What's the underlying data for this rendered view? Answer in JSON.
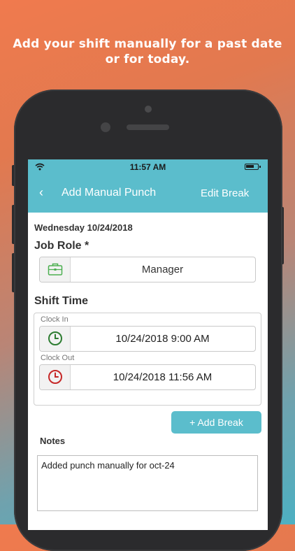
{
  "headline": {
    "line1": "Add your shift manually for a past date",
    "line2": "or for today."
  },
  "status_bar": {
    "time": "11:57 AM"
  },
  "nav": {
    "back_glyph": "‹",
    "title": "Add Manual Punch",
    "action": "Edit Break"
  },
  "form": {
    "date": "Wednesday 10/24/2018",
    "job_role_label": "Job Role *",
    "job_role_value": "Manager",
    "shift_time_label": "Shift Time",
    "clock_in_label": "Clock In",
    "clock_in_value": "10/24/2018 9:00 AM",
    "clock_out_label": "Clock Out",
    "clock_out_value": "10/24/2018 11:56 AM",
    "add_break_label": "+ Add Break",
    "notes_label": "Notes",
    "notes_value": "Added punch manually for oct-24"
  },
  "colors": {
    "accent": "#5bbdcc",
    "briefcase_icon": "#4caf50",
    "clock_in_icon": "#2e7d32",
    "clock_out_icon": "#c62828"
  },
  "icons": {
    "briefcase": "briefcase-icon",
    "clock_in": "clock-in-icon",
    "clock_out": "clock-out-icon"
  }
}
